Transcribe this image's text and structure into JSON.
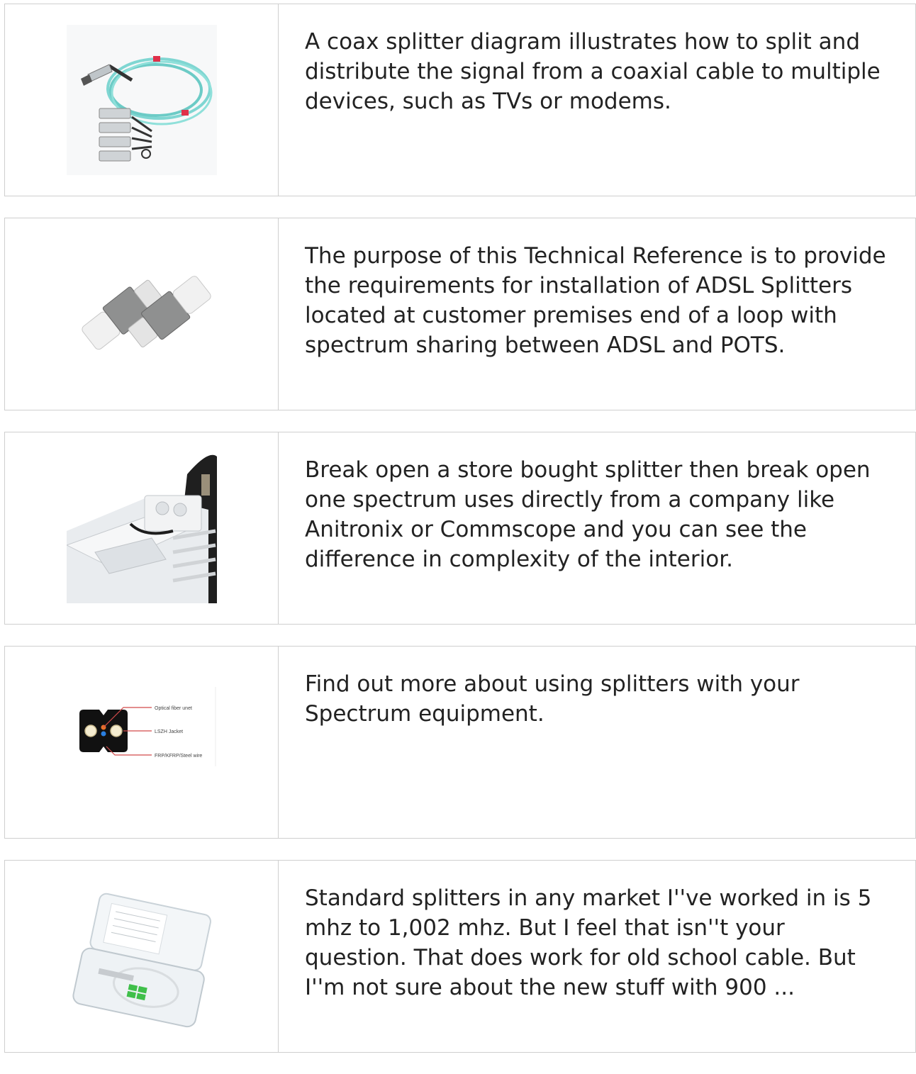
{
  "results": [
    {
      "text": "A coax splitter diagram illustrates how to split and distribute the signal from a coaxial cable to multiple devices, such as TVs or modems.",
      "image": "aoc-breakout-cable-thumbnail"
    },
    {
      "text": "The purpose of this Technical Reference is to provide the requirements for installation of ADSL Splitters located at customer premises end of a loop with spectrum sharing between ADSL and POTS.",
      "image": "fiber-adapter-pair-thumbnail"
    },
    {
      "text": "Break open a store bought splitter then break open one spectrum uses directly from a company like Anitronix or Commscope and you can see the difference in complexity of the interior.",
      "image": "splitter-housing-interior-thumbnail"
    },
    {
      "text": "Find out more about using splitters with your Spectrum equipment.",
      "image": "drop-cable-cross-section-thumbnail",
      "diagram_labels": [
        "Optical fiber unet",
        "LSZH Jacket",
        "FRP/KFRP/Steel wire"
      ]
    },
    {
      "text": "Standard splitters in any market I''ve worked in is 5 mhz to 1,002 mhz. But I feel that isn''t your question. That does work for old school cable. But I''m not sure about the new stuff with 900 ...",
      "image": "plc-splitter-box-thumbnail"
    }
  ]
}
